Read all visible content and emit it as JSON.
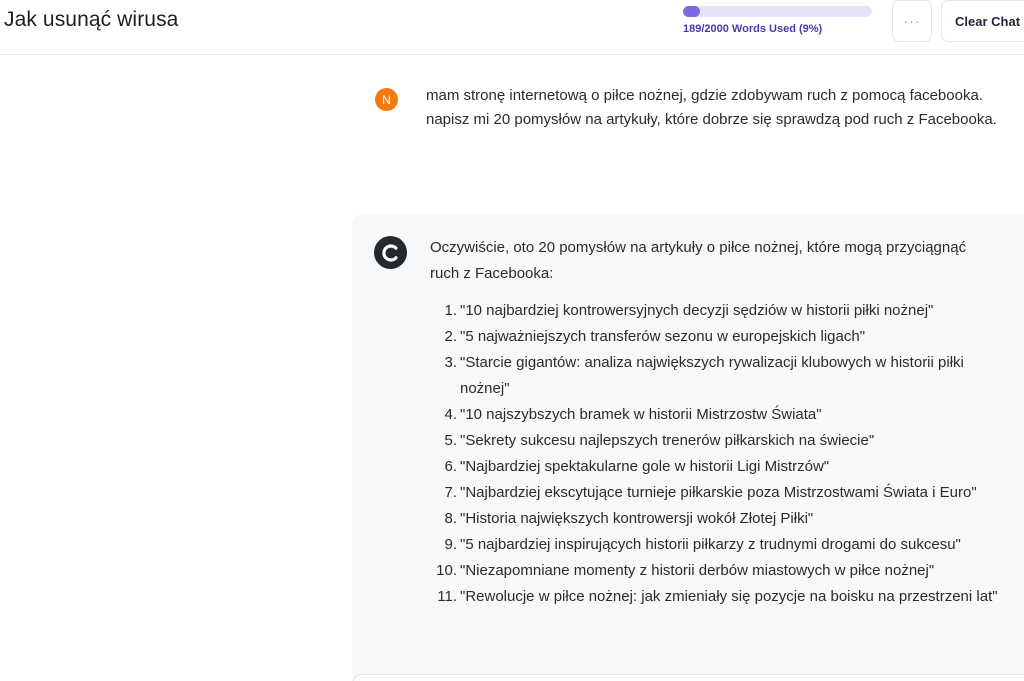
{
  "header": {
    "title": "Jak usunąć wirusa",
    "usage_text": "189/2000 Words Used (9%)",
    "usage_fraction": 0.09,
    "more_label": "···",
    "clear_label": "Clear Chat"
  },
  "user_message": {
    "avatar_letter": "N",
    "text": "mam stronę internetową o piłce nożnej, gdzie zdobywam ruch z pomocą facebooka. napisz mi 20 pomysłów na artykuły, które dobrze się sprawdzą pod ruch z Facebooka."
  },
  "assistant_message": {
    "intro": "Oczywiście, oto 20 pomysłów na artykuły o piłce nożnej, które mogą przyciągnąć ruch z Facebooka:",
    "items": [
      {
        "num": "1.",
        "text": "\"10 najbardziej kontrowersyjnych decyzji sędziów w historii piłki nożnej\""
      },
      {
        "num": "2.",
        "text": "\"5 najważniejszych transferów sezonu w europejskich ligach\""
      },
      {
        "num": "3.",
        "text": "\"Starcie gigantów: analiza największych rywalizacji klubowych w historii piłki nożnej\""
      },
      {
        "num": "4.",
        "text": "\"10 najszybszych bramek w historii Mistrzostw Świata\""
      },
      {
        "num": "5.",
        "text": "\"Sekrety sukcesu najlepszych trenerów piłkarskich na świecie\""
      },
      {
        "num": "6.",
        "text": "\"Najbardziej spektakularne gole w historii Ligi Mistrzów\""
      },
      {
        "num": "7.",
        "text": "\"Najbardziej ekscytujące turnieje piłkarskie poza Mistrzostwami Świata i Euro\""
      },
      {
        "num": "8.",
        "text": "\"Historia największych kontrowersji wokół Złotej Piłki\""
      },
      {
        "num": "9.",
        "text": "\"5 najbardziej inspirujących historii piłkarzy z trudnymi drogami do sukcesu\""
      },
      {
        "num": "10.",
        "text": "\"Niezapomniane momenty z historii derbów miastowych w piłce nożnej\""
      },
      {
        "num": "11.",
        "text": "\"Rewolucje w piłce nożnej: jak zmieniały się pozycje na boisku na przestrzeni lat\""
      }
    ]
  },
  "colors": {
    "user_avatar": "#f27a11",
    "assistant_avatar": "#232a2f",
    "usage_fill": "#7a6be0",
    "usage_text": "#4b3aa8"
  },
  "icons": {
    "more": "more-dots-icon",
    "assistant_logo": "c-logo-icon"
  }
}
